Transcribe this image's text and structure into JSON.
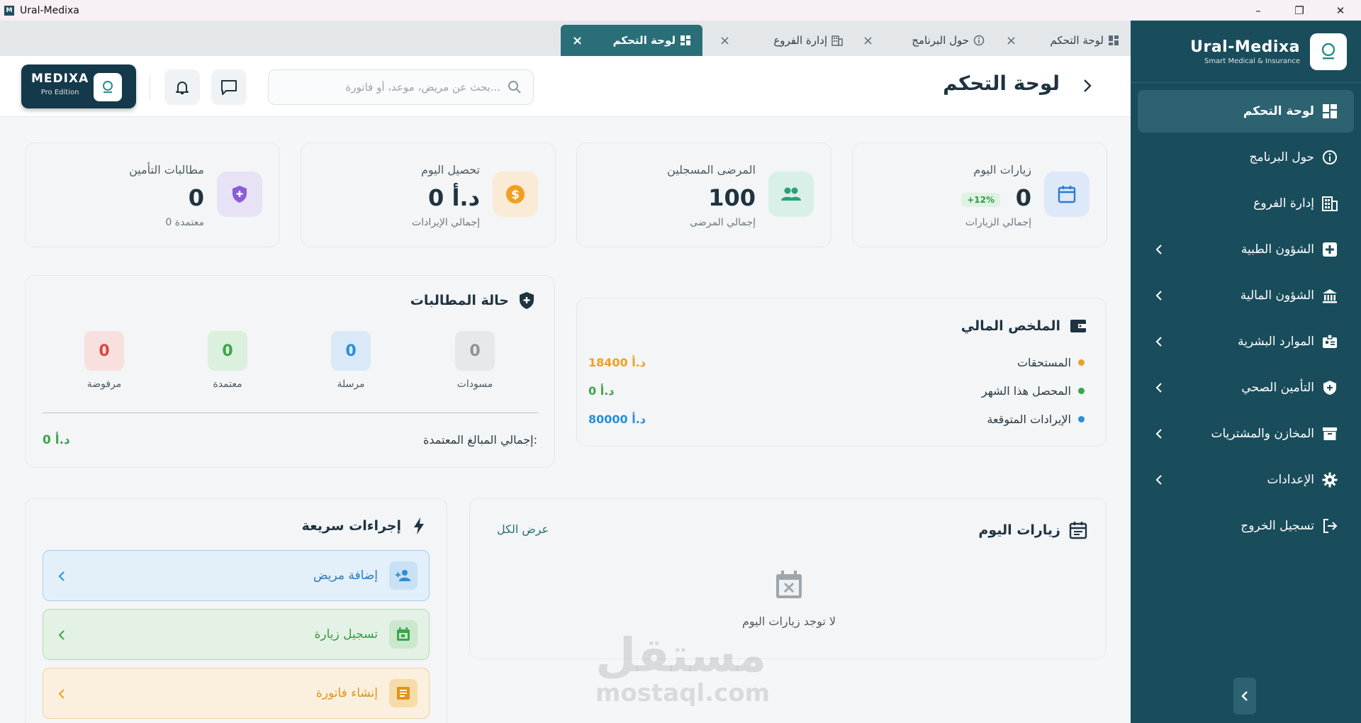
{
  "window": {
    "title": "Ural-Medixa"
  },
  "sidebar": {
    "brand_name": "Ural-Medixa",
    "brand_sub": "Smart Medical & Insurance",
    "items": [
      {
        "label": "لوحة التحكم",
        "icon": "dashboard-icon"
      },
      {
        "label": "حول البرنامج",
        "icon": "info-icon"
      },
      {
        "label": "إدارة الفروع",
        "icon": "building-icon"
      },
      {
        "label": "الشؤون الطبية",
        "icon": "medical-plus-icon"
      },
      {
        "label": "الشؤون المالية",
        "icon": "bank-icon"
      },
      {
        "label": "الموارد البشرية",
        "icon": "badge-icon"
      },
      {
        "label": "التأمين الصحي",
        "icon": "shield-plus-icon"
      },
      {
        "label": "المخازن والمشتريات",
        "icon": "warehouse-icon"
      },
      {
        "label": "الإعدادات",
        "icon": "gear-icon"
      },
      {
        "label": "تسجيل الخروج",
        "icon": "logout-icon"
      }
    ]
  },
  "tabs": [
    {
      "label": "لوحة التحكم"
    },
    {
      "label": "حول البرنامج"
    },
    {
      "label": "إدارة الفروع"
    },
    {
      "label": "لوحة التحكم"
    }
  ],
  "header": {
    "title": "لوحة التحكم",
    "search_placeholder": "بحث عن مريض، موعد، أو فاتورة...",
    "logo_name": "MEDIXA",
    "logo_edition": "Pro Edition"
  },
  "stats": [
    {
      "label": "زيارات اليوم",
      "value": "0",
      "badge": "+12%",
      "sub": "إجمالي الزيارات"
    },
    {
      "label": "المرضى المسجلين",
      "value": "100",
      "sub": "إجمالي المرضى"
    },
    {
      "label": "تحصيل اليوم",
      "value": "0 د.أ",
      "sub": "إجمالي الإيرادات"
    },
    {
      "label": "مطالبات التأمين",
      "value": "0",
      "sub": "0 معتمدة"
    }
  ],
  "financial": {
    "title": "الملخص المالي",
    "rows": [
      {
        "label": "المستحقات",
        "value": "18400 د.أ",
        "color": "#f0a020"
      },
      {
        "label": "المحصل هذا الشهر",
        "value": "0 د.أ",
        "color": "#3aa64a"
      },
      {
        "label": "الإيرادات المتوقعة",
        "value": "80000 د.أ",
        "color": "#2b8fd6"
      }
    ]
  },
  "claims": {
    "title": "حالة المطالبات",
    "items": [
      {
        "label": "مسودات",
        "value": "0"
      },
      {
        "label": "مرسلة",
        "value": "0"
      },
      {
        "label": "معتمدة",
        "value": "0"
      },
      {
        "label": "مرفوضة",
        "value": "0"
      }
    ],
    "total_label": "إجمالي المبالغ المعتمدة:",
    "total_value": "0 د.أ"
  },
  "visits": {
    "title": "زيارات اليوم",
    "view_all": "عرض الكل",
    "empty": "لا توجد زيارات اليوم"
  },
  "quick": {
    "title": "إجراءات سريعة",
    "actions": [
      {
        "label": "إضافة مريض"
      },
      {
        "label": "تسجيل زيارة"
      },
      {
        "label": "إنشاء فاتورة"
      }
    ]
  },
  "watermark": {
    "ar": "مستقل",
    "en": "mostaql.com"
  },
  "colors": {
    "sidebar": "#1a4d5b",
    "accent": "#2a6e78",
    "dark": "#14394a"
  }
}
